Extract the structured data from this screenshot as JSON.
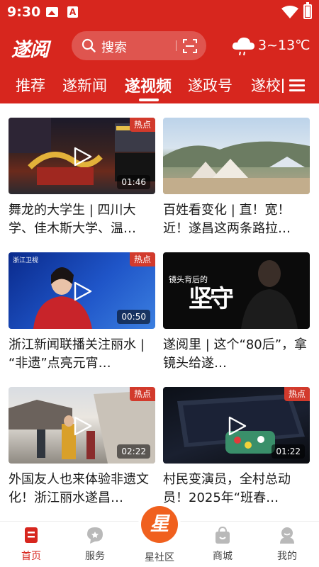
{
  "status_bar": {
    "time": "9:30"
  },
  "header": {
    "logo": "遂阅",
    "search_placeholder": "搜索",
    "weather": "3~13℃"
  },
  "tabs": [
    {
      "label": "推荐",
      "active": false
    },
    {
      "label": "遂新闻",
      "active": false
    },
    {
      "label": "遂视频",
      "active": true
    },
    {
      "label": "遂政号",
      "active": false
    },
    {
      "label": "遂校",
      "active": false
    }
  ],
  "videos": [
    {
      "title": "舞龙的大学生 | 四川大学、佳木斯大学、温…",
      "badge": "热点",
      "duration": "01:46"
    },
    {
      "title": "百姓看变化 | 直！宽！近！遂昌这两条路拉…",
      "badge": "",
      "duration": ""
    },
    {
      "title": "浙江新闻联播关注丽水 | “非遗”点亮元宵…",
      "badge": "热点",
      "duration": "00:50"
    },
    {
      "title": "遂阅里 | 这个“80后”，拿镜头给遂…",
      "badge": "",
      "duration": "",
      "thumb_caption": "镜头背后的",
      "thumb_big": "坚守"
    },
    {
      "title": "外国友人也来体验非遗文化！浙江丽水遂昌…",
      "badge": "热点",
      "duration": "02:22"
    },
    {
      "title": "村民变演员，全村总动员！2025年“班春…",
      "badge": "热点",
      "duration": "01:22"
    }
  ],
  "thumb_texts": {
    "news_channel": "浙江卫视"
  },
  "bottom_nav": [
    {
      "label": "首页",
      "icon": "home-icon",
      "active": true
    },
    {
      "label": "服务",
      "icon": "service-icon",
      "active": false
    },
    {
      "label": "星社区",
      "icon": "star-community-icon",
      "active": false,
      "center_glyph": "星"
    },
    {
      "label": "商城",
      "icon": "shop-bag-icon",
      "active": false
    },
    {
      "label": "我的",
      "icon": "profile-icon",
      "active": false
    }
  ],
  "colors": {
    "brand_red": "#d7261e",
    "hot_badge": "#d23a2c",
    "star_orange": "#f0601e"
  }
}
